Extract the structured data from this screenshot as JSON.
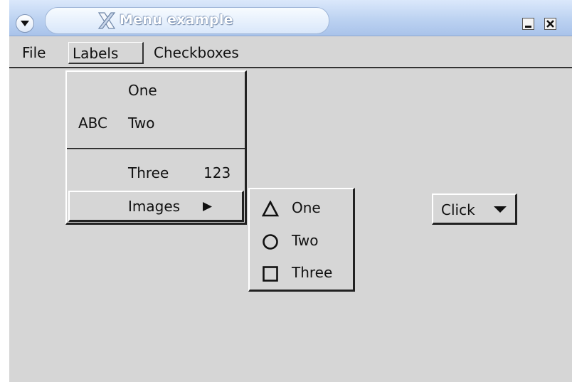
{
  "window": {
    "title": "Menu example"
  },
  "menubar": {
    "items": [
      {
        "label": "File"
      },
      {
        "label": "Labels",
        "active": true
      },
      {
        "label": "Checkboxes"
      }
    ]
  },
  "labels_menu": {
    "items": [
      {
        "prefix": "",
        "label": "One",
        "accelerator": ""
      },
      {
        "prefix": "ABC",
        "label": "Two",
        "accelerator": ""
      },
      {
        "prefix": "",
        "label": "Three",
        "accelerator": "123"
      },
      {
        "prefix": "",
        "label": "Images",
        "submenu_arrow": "triangle-right-icon",
        "highlighted": true
      }
    ]
  },
  "images_submenu": {
    "items": [
      {
        "icon": "triangle-icon",
        "label": "One"
      },
      {
        "icon": "circle-icon",
        "label": "Two"
      },
      {
        "icon": "square-icon",
        "label": "Three"
      }
    ]
  },
  "click_button": {
    "label": "Click",
    "icon": "caret-down-icon"
  }
}
